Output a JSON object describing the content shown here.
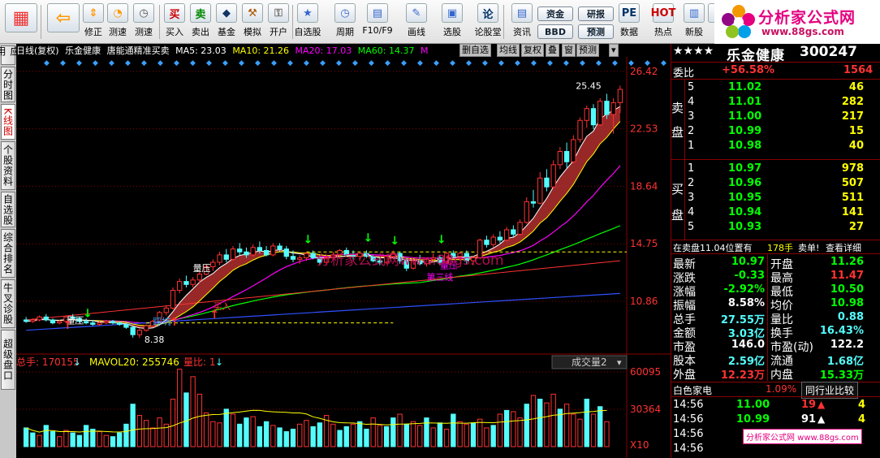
{
  "toolbar": {
    "buttons": [
      {
        "label": "",
        "icon": "grid-icon"
      },
      {
        "label": "",
        "icon": "back-arrow-icon"
      },
      {
        "label": "修正",
        "icon": "up-down-icon"
      },
      {
        "label": "测速",
        "icon": "speed-icon"
      },
      {
        "label": "测速",
        "icon": "clock-icon"
      },
      {
        "label": "买入",
        "icon": "buy-icon",
        "glyph": "买"
      },
      {
        "label": "卖出",
        "icon": "sell-icon",
        "glyph": "卖"
      },
      {
        "label": "基金",
        "icon": "fund-icon"
      },
      {
        "label": "模拟",
        "icon": "hammer-icon"
      },
      {
        "label": "开户",
        "icon": "lock-icon"
      },
      {
        "label": "自选股",
        "icon": "star-icon"
      },
      {
        "label": "周期",
        "icon": "period-icon"
      },
      {
        "label": "F10/F9",
        "icon": "f10-icon"
      },
      {
        "label": "画线",
        "icon": "pen-icon"
      },
      {
        "label": "选股",
        "icon": "select-icon"
      },
      {
        "label": "论股堂",
        "icon": "forum-icon",
        "glyph": "论"
      },
      {
        "label": "资讯",
        "icon": "news-icon"
      },
      {
        "label": "数据",
        "icon": "pe-icon",
        "glyph": "PE"
      },
      {
        "label": "热点",
        "icon": "hot-icon",
        "glyph": "HOT"
      },
      {
        "label": "新股",
        "icon": "newstock-icon"
      },
      {
        "label": "消",
        "icon": "msg-icon"
      }
    ],
    "fund_label": "资金",
    "bbd_label": "BBD",
    "research_label": "研报",
    "forecast_label": "预测"
  },
  "logo": {
    "title": "分析家公式网",
    "url": "www.88gs.com"
  },
  "left_tabs": [
    "应用",
    "分时图",
    "K线图",
    "个股资料",
    "自选股",
    "综合排名",
    "牛叉诊股",
    "超级盘口"
  ],
  "chart_info": {
    "period": "日线(复权)",
    "stock": "乐金健康",
    "indicator": "唐能通精准买卖",
    "ma5": "MA5: 23.03",
    "ma10": "MA10: 21.26",
    "ma20": "MA20: 17.03",
    "ma60": "MA60: 14.37",
    "extra": "M",
    "buttons": [
      "删自选",
      "均线",
      "复权",
      "叠",
      "窗",
      "预测"
    ]
  },
  "chart_colors": {
    "bg": "#000000",
    "up": "#ff3232",
    "down": "#54fcfc",
    "ma5": "#ffffff",
    "ma10": "#ffff00",
    "ma20": "#ff00ff",
    "ma60": "#00ff00",
    "grid": "#8b0000",
    "axis_text": "#ff3232",
    "band": "#b32f2f"
  },
  "chart_data": {
    "type": "candlestick",
    "y_ticks": [
      "26.42",
      "22.53",
      "18.64",
      "14.75",
      "10.86"
    ],
    "price_ticks_values": [
      26.42,
      22.53,
      18.64,
      14.75,
      10.86
    ],
    "ylim": [
      7.4,
      27.4
    ],
    "high_label": "25.45",
    "low_label": "8.38",
    "annotations": [
      "量压",
      "量压",
      "踩坑",
      "买入",
      "量压",
      "第三线"
    ],
    "candles": [
      {
        "o": 9.6,
        "h": 9.8,
        "l": 9.4,
        "c": 9.5
      },
      {
        "o": 9.5,
        "h": 9.7,
        "l": 9.4,
        "c": 9.6
      },
      {
        "o": 9.6,
        "h": 9.9,
        "l": 9.5,
        "c": 9.8
      },
      {
        "o": 9.8,
        "h": 10.0,
        "l": 9.5,
        "c": 9.6
      },
      {
        "o": 9.6,
        "h": 9.7,
        "l": 9.3,
        "c": 9.4
      },
      {
        "o": 9.4,
        "h": 9.6,
        "l": 9.3,
        "c": 9.5
      },
      {
        "o": 9.5,
        "h": 9.9,
        "l": 9.4,
        "c": 9.8
      },
      {
        "o": 9.8,
        "h": 10.0,
        "l": 9.6,
        "c": 9.7
      },
      {
        "o": 9.7,
        "h": 9.8,
        "l": 9.4,
        "c": 9.5
      },
      {
        "o": 9.5,
        "h": 9.7,
        "l": 9.3,
        "c": 9.4
      },
      {
        "o": 9.4,
        "h": 9.6,
        "l": 9.2,
        "c": 9.3
      },
      {
        "o": 9.3,
        "h": 9.5,
        "l": 9.2,
        "c": 9.4
      },
      {
        "o": 9.4,
        "h": 9.6,
        "l": 9.3,
        "c": 9.5
      },
      {
        "o": 9.5,
        "h": 9.6,
        "l": 9.3,
        "c": 9.4
      },
      {
        "o": 9.4,
        "h": 9.5,
        "l": 9.2,
        "c": 9.3
      },
      {
        "o": 9.3,
        "h": 9.4,
        "l": 9.0,
        "c": 9.1
      },
      {
        "o": 9.1,
        "h": 9.2,
        "l": 8.4,
        "c": 8.6
      },
      {
        "o": 8.6,
        "h": 9.0,
        "l": 8.38,
        "c": 8.9
      },
      {
        "o": 8.9,
        "h": 9.3,
        "l": 8.8,
        "c": 9.2
      },
      {
        "o": 9.2,
        "h": 9.6,
        "l": 9.1,
        "c": 9.5
      },
      {
        "o": 9.5,
        "h": 10.2,
        "l": 9.4,
        "c": 10.1
      },
      {
        "o": 10.1,
        "h": 10.6,
        "l": 9.9,
        "c": 10.4
      },
      {
        "o": 10.4,
        "h": 11.8,
        "l": 10.3,
        "c": 11.6
      },
      {
        "o": 11.6,
        "h": 12.4,
        "l": 11.4,
        "c": 12.2
      },
      {
        "o": 12.2,
        "h": 12.6,
        "l": 11.8,
        "c": 12.0
      },
      {
        "o": 12.0,
        "h": 12.5,
        "l": 11.8,
        "c": 12.3
      },
      {
        "o": 12.3,
        "h": 12.9,
        "l": 12.1,
        "c": 12.7
      },
      {
        "o": 12.7,
        "h": 13.4,
        "l": 12.6,
        "c": 13.2
      },
      {
        "o": 13.2,
        "h": 13.7,
        "l": 12.9,
        "c": 13.5
      },
      {
        "o": 13.5,
        "h": 14.2,
        "l": 13.3,
        "c": 14.0
      },
      {
        "o": 14.0,
        "h": 14.4,
        "l": 13.5,
        "c": 13.7
      },
      {
        "o": 13.7,
        "h": 14.6,
        "l": 13.6,
        "c": 14.4
      },
      {
        "o": 14.4,
        "h": 14.8,
        "l": 14.0,
        "c": 14.2
      },
      {
        "o": 14.2,
        "h": 14.5,
        "l": 13.8,
        "c": 14.0
      },
      {
        "o": 14.0,
        "h": 14.7,
        "l": 13.9,
        "c": 14.5
      },
      {
        "o": 14.5,
        "h": 14.9,
        "l": 14.1,
        "c": 14.3
      },
      {
        "o": 14.3,
        "h": 14.6,
        "l": 13.9,
        "c": 14.0
      },
      {
        "o": 14.0,
        "h": 14.8,
        "l": 13.9,
        "c": 14.6
      },
      {
        "o": 14.6,
        "h": 14.8,
        "l": 14.2,
        "c": 14.4
      },
      {
        "o": 14.4,
        "h": 14.6,
        "l": 13.7,
        "c": 13.9
      },
      {
        "o": 13.9,
        "h": 14.3,
        "l": 13.5,
        "c": 13.7
      },
      {
        "o": 13.7,
        "h": 14.0,
        "l": 13.4,
        "c": 13.8
      },
      {
        "o": 13.8,
        "h": 14.2,
        "l": 13.6,
        "c": 14.1
      },
      {
        "o": 14.1,
        "h": 14.3,
        "l": 13.7,
        "c": 13.8
      },
      {
        "o": 13.8,
        "h": 14.0,
        "l": 13.3,
        "c": 13.5
      },
      {
        "o": 13.5,
        "h": 13.9,
        "l": 13.4,
        "c": 13.8
      },
      {
        "o": 13.8,
        "h": 14.2,
        "l": 13.7,
        "c": 14.0
      },
      {
        "o": 14.0,
        "h": 14.4,
        "l": 13.8,
        "c": 14.3
      },
      {
        "o": 14.3,
        "h": 14.5,
        "l": 13.9,
        "c": 14.0
      },
      {
        "o": 14.0,
        "h": 14.3,
        "l": 13.7,
        "c": 13.9
      },
      {
        "o": 13.9,
        "h": 14.2,
        "l": 13.6,
        "c": 14.1
      },
      {
        "o": 14.1,
        "h": 14.3,
        "l": 13.8,
        "c": 13.9
      },
      {
        "o": 13.9,
        "h": 14.0,
        "l": 13.5,
        "c": 13.6
      },
      {
        "o": 13.6,
        "h": 13.8,
        "l": 13.3,
        "c": 13.5
      },
      {
        "o": 13.5,
        "h": 14.0,
        "l": 13.4,
        "c": 13.9
      },
      {
        "o": 13.9,
        "h": 14.3,
        "l": 13.7,
        "c": 14.1
      },
      {
        "o": 14.1,
        "h": 14.2,
        "l": 13.4,
        "c": 13.6
      },
      {
        "o": 13.6,
        "h": 13.8,
        "l": 12.9,
        "c": 13.1
      },
      {
        "o": 13.1,
        "h": 13.7,
        "l": 13.0,
        "c": 13.6
      },
      {
        "o": 13.6,
        "h": 14.0,
        "l": 13.3,
        "c": 13.4
      },
      {
        "o": 13.4,
        "h": 13.8,
        "l": 13.2,
        "c": 13.7
      },
      {
        "o": 13.7,
        "h": 14.1,
        "l": 13.5,
        "c": 13.8
      },
      {
        "o": 13.8,
        "h": 14.0,
        "l": 13.3,
        "c": 13.5
      },
      {
        "o": 13.5,
        "h": 14.2,
        "l": 13.4,
        "c": 14.1
      },
      {
        "o": 14.1,
        "h": 14.3,
        "l": 13.8,
        "c": 13.9
      },
      {
        "o": 13.9,
        "h": 14.2,
        "l": 13.6,
        "c": 14.1
      },
      {
        "o": 14.1,
        "h": 14.3,
        "l": 13.4,
        "c": 13.6
      },
      {
        "o": 13.6,
        "h": 13.9,
        "l": 13.3,
        "c": 13.8
      },
      {
        "o": 13.8,
        "h": 15.1,
        "l": 13.7,
        "c": 15.0
      },
      {
        "o": 15.0,
        "h": 15.3,
        "l": 14.5,
        "c": 14.7
      },
      {
        "o": 14.7,
        "h": 15.4,
        "l": 14.5,
        "c": 15.2
      },
      {
        "o": 15.2,
        "h": 15.6,
        "l": 14.8,
        "c": 15.0
      },
      {
        "o": 15.0,
        "h": 15.9,
        "l": 14.9,
        "c": 15.7
      },
      {
        "o": 15.7,
        "h": 16.0,
        "l": 15.2,
        "c": 15.4
      },
      {
        "o": 15.4,
        "h": 16.4,
        "l": 15.3,
        "c": 16.2
      },
      {
        "o": 16.2,
        "h": 17.9,
        "l": 16.1,
        "c": 17.6
      },
      {
        "o": 17.6,
        "h": 18.4,
        "l": 17.2,
        "c": 17.5
      },
      {
        "o": 17.5,
        "h": 19.6,
        "l": 17.4,
        "c": 19.2
      },
      {
        "o": 19.2,
        "h": 19.8,
        "l": 18.3,
        "c": 18.6
      },
      {
        "o": 18.6,
        "h": 20.4,
        "l": 18.5,
        "c": 20.1
      },
      {
        "o": 20.1,
        "h": 21.3,
        "l": 19.8,
        "c": 21.0
      },
      {
        "o": 21.0,
        "h": 21.6,
        "l": 19.9,
        "c": 20.3
      },
      {
        "o": 20.3,
        "h": 22.1,
        "l": 20.2,
        "c": 21.8
      },
      {
        "o": 21.8,
        "h": 23.3,
        "l": 21.6,
        "c": 23.1
      },
      {
        "o": 23.1,
        "h": 24.1,
        "l": 22.6,
        "c": 23.9
      },
      {
        "o": 23.9,
        "h": 24.2,
        "l": 22.5,
        "c": 22.8
      },
      {
        "o": 22.8,
        "h": 24.6,
        "l": 22.7,
        "c": 24.4
      },
      {
        "o": 24.4,
        "h": 24.9,
        "l": 23.2,
        "c": 23.5
      },
      {
        "o": 23.5,
        "h": 24.6,
        "l": 22.2,
        "c": 24.3
      },
      {
        "o": 24.3,
        "h": 25.45,
        "l": 23.6,
        "c": 25.2
      }
    ],
    "volume": {
      "title": "总手: 170155",
      "mavol": "MAVOL20: 255746",
      "ratio": "量比: 1",
      "selector": "成交量2",
      "y_ticks": [
        "60095",
        "30364"
      ],
      "unit": "X10",
      "ylim": [
        0,
        650
      ],
      "values": [
        150,
        110,
        90,
        170,
        120,
        80,
        130,
        110,
        90,
        170,
        140,
        120,
        90,
        80,
        110,
        180,
        340,
        250,
        210,
        150,
        230,
        180,
        380,
        620,
        430,
        560,
        420,
        270,
        200,
        190,
        300,
        260,
        180,
        230,
        240,
        160,
        200,
        170,
        150,
        120,
        140,
        180,
        210,
        160,
        190,
        250,
        180,
        130,
        160,
        180,
        200,
        140,
        230,
        170,
        160,
        230,
        260,
        180,
        200,
        170,
        230,
        150,
        190,
        140,
        260,
        200,
        180,
        190,
        220,
        150,
        170,
        260,
        290,
        280,
        230,
        340,
        410,
        380,
        350,
        420,
        300,
        340,
        260,
        220,
        380,
        260,
        320,
        200
      ],
      "colors_up": [
        0,
        0,
        1,
        0,
        0,
        1,
        1,
        0,
        0,
        0,
        0,
        1,
        1,
        0,
        0,
        0,
        0,
        1,
        1,
        1,
        1,
        1,
        1,
        1,
        0,
        1,
        1,
        1,
        1,
        1,
        0,
        1,
        0,
        0,
        1,
        0,
        0,
        1,
        0,
        0,
        0,
        1,
        1,
        0,
        0,
        1,
        1,
        0,
        0,
        1,
        0,
        0,
        1,
        1,
        0,
        0,
        1,
        0,
        1,
        1,
        0,
        1,
        0,
        1,
        0,
        1,
        1,
        0,
        1,
        1,
        0,
        1,
        0,
        1,
        1,
        0,
        1,
        0,
        1,
        1,
        0,
        1,
        1,
        1,
        0,
        1,
        0,
        1
      ]
    }
  },
  "right_panel": {
    "stars": "★★★★",
    "name": "乐金健康",
    "code": "300247",
    "weibi_label": "委比",
    "weibi_pct": "+56.58%",
    "weibi_num": "1564",
    "sell_label": "卖盘",
    "buy_label": "买盘",
    "sell_orders": [
      {
        "lvl": "5",
        "price": "11.02",
        "vol": "46"
      },
      {
        "lvl": "4",
        "price": "11.01",
        "vol": "282"
      },
      {
        "lvl": "3",
        "price": "11.00",
        "vol": "217"
      },
      {
        "lvl": "2",
        "price": "10.99",
        "vol": "15"
      },
      {
        "lvl": "1",
        "price": "10.98",
        "vol": "40"
      }
    ],
    "buy_orders": [
      {
        "lvl": "1",
        "price": "10.97",
        "vol": "978"
      },
      {
        "lvl": "2",
        "price": "10.96",
        "vol": "507"
      },
      {
        "lvl": "3",
        "price": "10.95",
        "vol": "511"
      },
      {
        "lvl": "4",
        "price": "10.94",
        "vol": "141"
      },
      {
        "lvl": "5",
        "price": "10.93",
        "vol": "27"
      }
    ],
    "note_left": "在卖盘11.04位置有",
    "note_vol": "178手",
    "note_right": "卖单!",
    "note_link": "查看详细",
    "quote_rows": [
      {
        "k1": "最新",
        "v1": "10.97",
        "k2": "开盘",
        "v2": "11.26",
        "c1": "#00ff00",
        "c2": "#00ff00"
      },
      {
        "k1": "涨跌",
        "v1": "-0.33",
        "k2": "最高",
        "v2": "11.47",
        "c1": "#00ff00",
        "c2": "#ff3232"
      },
      {
        "k1": "涨幅",
        "v1": "-2.92%",
        "k2": "最低",
        "v2": "10.50",
        "c1": "#00ff00",
        "c2": "#00ff00"
      },
      {
        "k1": "振幅",
        "v1": "8.58%",
        "k2": "均价",
        "v2": "10.98",
        "c1": "#ffffff",
        "c2": "#00ff00"
      },
      {
        "k1": "总手",
        "v1": "27.55万",
        "k2": "量比",
        "v2": "0.88",
        "c1": "#54fcfc",
        "c2": "#54fcfc"
      },
      {
        "k1": "金额",
        "v1": "3.03亿",
        "k2": "换手",
        "v2": "16.43%",
        "c1": "#54fcfc",
        "c2": "#54fcfc"
      },
      {
        "k1": "市盈",
        "v1": "146.0",
        "k2": "市盈(动)",
        "v2": "122.2",
        "c1": "#ffffff",
        "c2": "#ffffff"
      },
      {
        "k1": "股本",
        "v1": "2.59亿",
        "k2": "流通",
        "v2": "1.68亿",
        "c1": "#54fcfc",
        "c2": "#54fcfc"
      },
      {
        "k1": "外盘",
        "v1": "12.23万",
        "k2": "内盘",
        "v2": "15.33万",
        "c1": "#ff3232",
        "c2": "#00ff00"
      }
    ],
    "sector_name": "白色家电",
    "sector_pct": "1.09%",
    "compare_btn": "同行业比较",
    "ticks": [
      {
        "time": "14:56",
        "price": "11.00",
        "vol": "19",
        "dir": "up",
        "col": "#ff3232",
        "n": "4"
      },
      {
        "time": "14:56",
        "price": "10.99",
        "vol": "91",
        "dir": "up",
        "col": "#ffffff",
        "n": "4"
      },
      {
        "time": "14:56",
        "price": "",
        "vol": "",
        "dir": "",
        "col": "#ffffff",
        "n": ""
      },
      {
        "time": "14:56",
        "price": "",
        "vol": "",
        "dir": "",
        "col": "#ffffff",
        "n": ""
      }
    ],
    "watermark_badge": "分析家公式网 www.88gs.com"
  },
  "watermark": "分析家公式网www.88gs.com"
}
